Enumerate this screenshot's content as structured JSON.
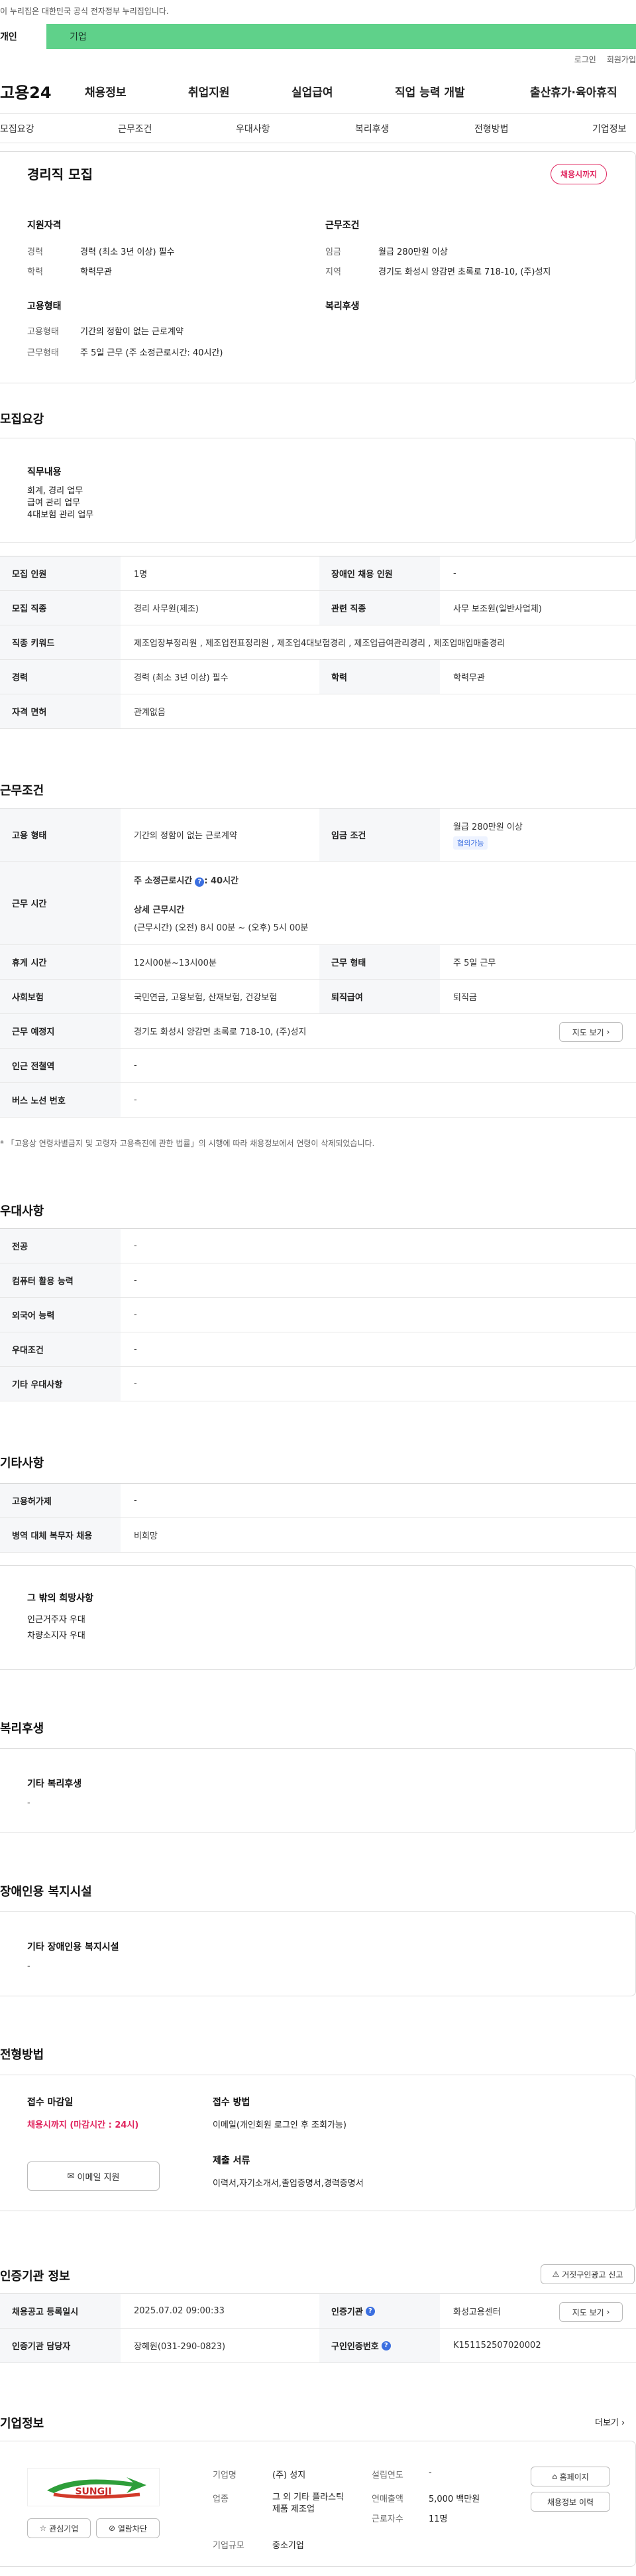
{
  "gov_notice": "이 누리집은 대한민국 공식 전자정부 누리집입니다.",
  "top_tabs": [
    "개인",
    "기업"
  ],
  "util": [
    "로그인",
    "회원가입"
  ],
  "logo": "고용24",
  "gnb": [
    "채용정보",
    "취업지원",
    "실업급여",
    "직업 능력 개발",
    "출산휴가·육아휴직"
  ],
  "subnav": [
    "모집요강",
    "근무조건",
    "우대사항",
    "복리후생",
    "전형방법",
    "기업정보"
  ],
  "summary": {
    "title": "경리직 모집",
    "status": "채용시까지",
    "qual_title": "지원자격",
    "career_l": "경력",
    "career": "경력 (최소 3년 이상) 필수",
    "edu_l": "학력",
    "edu": "학력무관",
    "cond_title": "근무조건",
    "wage_l": "임금",
    "wage": "월급 280만원 이상",
    "region_l": "지역",
    "region": "경기도 화성시 양감면 초록로 718-10, (주)성지",
    "emp_title": "고용형태",
    "emptype_l": "고용형태",
    "emptype": "기간의 정함이 없는 근로계약",
    "workform_l": "근무형태",
    "workform": "주 5일 근무 (주 소정근로시간: 40시간)",
    "welfare_title": "복리후생"
  },
  "recruit": {
    "heading": "모집요강",
    "duty_title": "직무내용",
    "duties": [
      "회계, 경리 업무",
      "급여 관리 업무",
      "4대보험 관리 업무"
    ],
    "rows": [
      {
        "k1": "모집 인원",
        "v1": "1명",
        "k2": "장애인 채용 인원",
        "v2": "-"
      },
      {
        "k1": "모집 직종",
        "v1": "경리 사무원(제조)",
        "k2": "관련 직종",
        "v2": "사무 보조원(일반사업체)"
      },
      {
        "k1": "직종 키워드",
        "v1": "제조업장부정리원 , 제조업전표정리원 , 제조업4대보험경리 , 제조업급여관리경리 , 제조업매입매출경리"
      },
      {
        "k1": "경력",
        "v1": "경력 (최소 3년 이상) 필수",
        "k2": "학력",
        "v2": "학력무관"
      },
      {
        "k1": "자격 면허",
        "v1": "관계없음"
      }
    ]
  },
  "work": {
    "heading": "근무조건",
    "emp_k": "고용 형태",
    "emp_v": "기간의 정함이 없는 근로계약",
    "wage_k": "임금 조건",
    "wage_v": "월급 280만원 이상",
    "wage_badge": "협의가능",
    "time_k": "근무 시간",
    "time_a": "주 소정근로시간",
    "time_a_v": ": 40시간",
    "time_b": "상세 근무시간",
    "time_c": "(근무시간) (오전) 8시 00분 ~ (오후) 5시 00분",
    "rest_k": "휴게 시간",
    "rest_v": "12시00분~13시00분",
    "form_k": "근무 형태",
    "form_v": "주 5일 근무",
    "ins_k": "사회보험",
    "ins_v": "국민연금, 고용보험, 산재보험, 건강보험",
    "ret_k": "퇴직급여",
    "ret_v": "퇴직금",
    "place_k": "근무 예정지",
    "place_v": "경기도 화성시 양감면 초록로 718-10, (주)성지",
    "map_btn": "지도 보기",
    "sub_k": "인근 전철역",
    "sub_v": "-",
    "bus_k": "버스 노선 번호",
    "bus_v": "-",
    "note": "* 「고용상 연령차별금지 및 고령자 고용촉진에 관한 법률」의 시행에 따라 채용정보에서 연령이 삭제되었습니다."
  },
  "pref": {
    "heading": "우대사항",
    "rows": [
      [
        "전공",
        "-"
      ],
      [
        "컴퓨터 활용 능력",
        "-"
      ],
      [
        "외국어 능력",
        "-"
      ],
      [
        "우대조건",
        "-"
      ],
      [
        "기타 우대사항",
        "-"
      ]
    ]
  },
  "etc": {
    "heading": "기타사항",
    "rows": [
      [
        "고용허가제",
        "-"
      ],
      [
        "병역 대체 복무자 채용",
        "비희망"
      ]
    ],
    "extra_title": "그 밖의 희망사항",
    "extra": [
      "인근거주자 우대",
      "차량소지자 우대"
    ]
  },
  "welfare": {
    "heading": "복리후생",
    "title": "기타 복리후생",
    "val": "-"
  },
  "disab": {
    "heading": "장애인용 복지시설",
    "title": "기타 장애인용 복지시설",
    "val": "-"
  },
  "screen": {
    "heading": "전형방법",
    "deadline_t": "접수 마감일",
    "deadline": "채용시까지 (마감시간 : 24시)",
    "apply_btn": "이메일 지원",
    "method_t": "접수 방법",
    "method": "이메일(개인회원 로그인 후 조회가능)",
    "docs_t": "제출 서류",
    "docs": "이력서,자기소개서,졸업증명서,경력증명서"
  },
  "agency": {
    "heading": "인증기관 정보",
    "report_btn": "거짓구인광고 신고",
    "reg_k": "채용공고 등록일시",
    "reg_v": "2025.07.02 09:00:33",
    "org_k": "인증기관",
    "org_v": "화성고용센터",
    "map_btn": "지도 보기",
    "mgr_k": "인증기관 담당자",
    "mgr_v": "장혜원(031-290-0823)",
    "no_k": "구인인증번호",
    "no_v": "K151152507020002"
  },
  "company": {
    "heading": "기업정보",
    "more": "더보기",
    "logo_text": "SUNGJI",
    "fav": "관심기업",
    "block": "열람차단",
    "name_k": "기업명",
    "name_v": "(주) 성지",
    "ind_k": "업종",
    "ind_v": "그 외 기타 플라스틱 제품 제조업",
    "size_k": "기업규모",
    "size_v": "중소기업",
    "est_k": "설립연도",
    "est_v": "-",
    "sales_k": "연매출액",
    "sales_v": "5,000 백만원",
    "emp_k": "근로자수",
    "emp_v": "11명",
    "home_btn": "홈페이지",
    "hist_btn": "채용정보 이력"
  },
  "colors": {
    "green": "#5fd18a",
    "red": "#e0245e",
    "blue": "#3b6fe0"
  }
}
